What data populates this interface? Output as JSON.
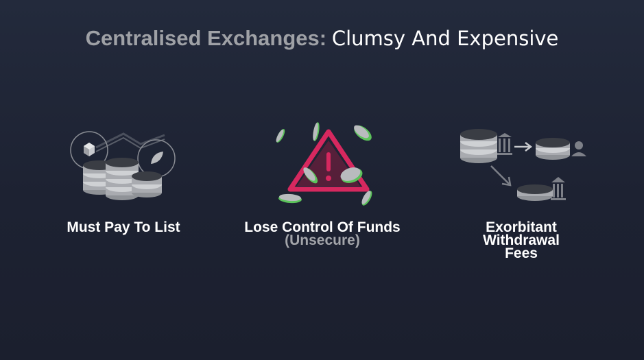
{
  "slide": {
    "title_bold": "Centralised Exchanges:",
    "title_light": "Clumsy And Expensive"
  },
  "features": [
    {
      "label": "Must Pay To List",
      "icon": "coin-stacks-with-token-badges-icon"
    },
    {
      "label": "Lose Control Of Funds",
      "sublabel": "(Unsecure)",
      "icon": "warning-triangle-with-flying-coins-icon"
    },
    {
      "label_lines": [
        "Exorbitant",
        "Withdrawal",
        "Fees"
      ],
      "icon": "coins-transfer-bank-user-icon"
    }
  ],
  "colors": {
    "background": "#1e2435",
    "title_bold": "#9fa1a6",
    "title_light": "#ffffff",
    "caption": "#ffffff",
    "sub_caption": "#a3a5aa",
    "warning": "#d6285f",
    "coin_accent": "#5cc35b",
    "coin_metal": "#b9bbbe"
  }
}
